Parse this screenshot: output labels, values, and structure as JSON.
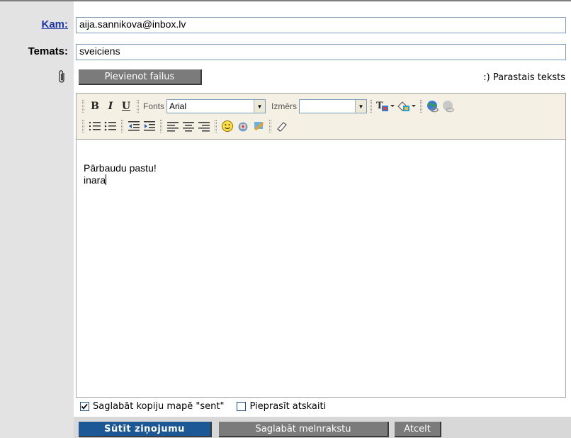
{
  "form": {
    "to_label": "Kam:",
    "to_value": "aija.sannikova@inbox.lv",
    "subject_label": "Temats:",
    "subject_value": "sveiciens",
    "attach_button": "Pievienot failus",
    "plain_text_link": ":) Parastais teksts"
  },
  "toolbar": {
    "bold": "B",
    "italic": "I",
    "underline": "U",
    "font_label": "Fonts",
    "font_value": "Arial",
    "size_label": "Izmērs",
    "size_value": ""
  },
  "editor": {
    "lines": [
      "Pārbaudu pastu!",
      "inara"
    ]
  },
  "options": {
    "save_copy_label": "Saglabāt kopiju mapē \"sent\"",
    "save_copy_checked": true,
    "read_receipt_label": "Pieprasīt atskaiti",
    "read_receipt_checked": false
  },
  "actions": {
    "send": "Sūtīt ziņojumu",
    "save_draft": "Saglabāt melnrakstu",
    "cancel": "Atcelt"
  },
  "colors": {
    "link": "#1c35a8",
    "send_button": "#1d5896",
    "gray_button": "#7b7b7b",
    "toolbar_bg": "#f4f0e4"
  }
}
